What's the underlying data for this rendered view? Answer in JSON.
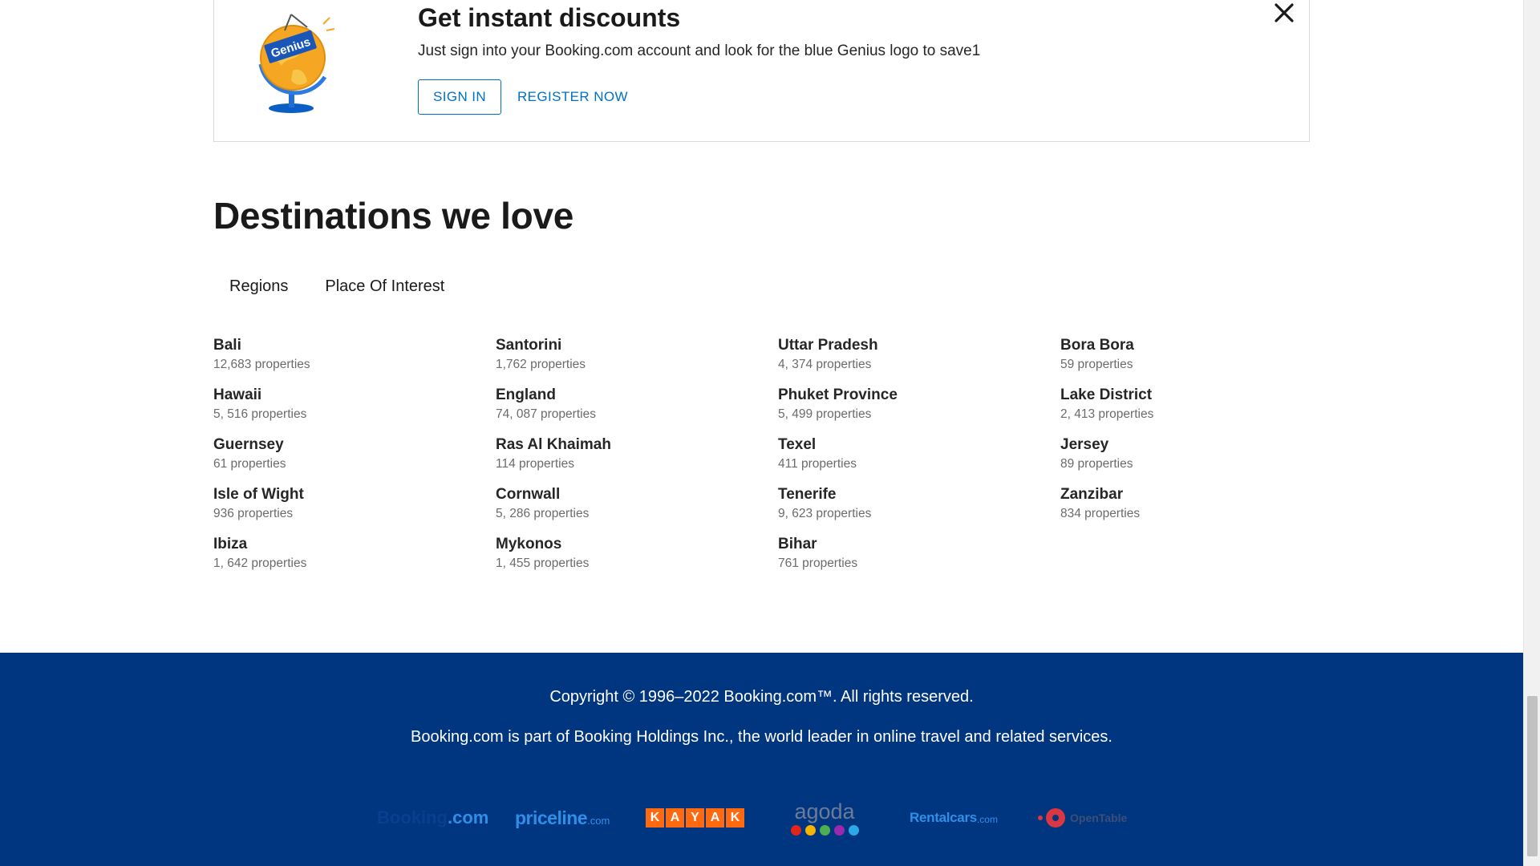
{
  "banner": {
    "title": "Get instant discounts",
    "description": "Just sign into your Booking.com account and look for the blue Genius logo to save1",
    "sign_in_label": "SIGN IN",
    "register_label": "REGISTER NOW",
    "genius_logo_text": "Genius"
  },
  "destinations": {
    "title": "Destinations we love",
    "tabs": [
      {
        "label": "Regions"
      },
      {
        "label": "Place Of Interest"
      }
    ],
    "columns": [
      [
        {
          "name": "Bali",
          "count": "12,683 properties"
        },
        {
          "name": "Hawaii",
          "count": "5, 516 properties"
        },
        {
          "name": "Guernsey",
          "count": "61 properties"
        },
        {
          "name": "Isle of Wight",
          "count": "936 properties"
        },
        {
          "name": "Ibiza",
          "count": "1, 642 properties"
        }
      ],
      [
        {
          "name": "Santorini",
          "count": "1,762 properties"
        },
        {
          "name": "England",
          "count": "74, 087 properties"
        },
        {
          "name": "Ras Al Khaimah",
          "count": "114 properties"
        },
        {
          "name": "Cornwall",
          "count": "5, 286 properties"
        },
        {
          "name": "Mykonos",
          "count": "1, 455 properties"
        }
      ],
      [
        {
          "name": "Uttar Pradesh",
          "count": "4, 374 properties"
        },
        {
          "name": "Phuket Province",
          "count": "5, 499 properties"
        },
        {
          "name": "Texel",
          "count": "411 properties"
        },
        {
          "name": "Tenerife",
          "count": "9, 623 properties"
        },
        {
          "name": "Bihar",
          "count": "761 properties"
        }
      ],
      [
        {
          "name": "Bora Bora",
          "count": "59 properties"
        },
        {
          "name": "Lake District",
          "count": "2, 413 properties"
        },
        {
          "name": "Jersey",
          "count": "89 properties"
        },
        {
          "name": "Zanzibar",
          "count": "834 properties"
        }
      ]
    ]
  },
  "footer": {
    "copyright": "Copyright © 1996–2022 Booking.com™. All rights reserved.",
    "part_of": "Booking.com is part of Booking Holdings Inc., the world leader in online travel and related services.",
    "brands": {
      "booking": {
        "main": "Booking",
        "suffix": ".com"
      },
      "priceline": {
        "main": "priceline",
        "suffix": ".com"
      },
      "kayak": {
        "letters": [
          "K",
          "A",
          "Y",
          "A",
          "K"
        ]
      },
      "agoda": {
        "main": "agoda"
      },
      "rentalcars": {
        "main": "Rentalcars",
        "suffix": ".com"
      },
      "opentable": {
        "main": "OpenTable"
      }
    },
    "colors": {
      "background": "#003580",
      "kayak": "#ff690f",
      "agoda_dots": [
        "#e2251b",
        "#f7b500",
        "#4caf50",
        "#9c27b0",
        "#2fa6e8"
      ]
    }
  }
}
